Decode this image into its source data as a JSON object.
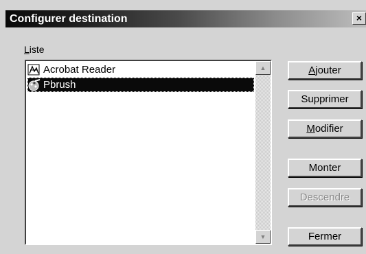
{
  "window": {
    "title": "Configurer destination",
    "close_label": "×"
  },
  "list": {
    "label_mnemonic": "L",
    "label_rest": "iste",
    "items": [
      {
        "label": "Acrobat Reader",
        "icon": "acrobat-icon",
        "selected": false
      },
      {
        "label": "Pbrush",
        "icon": "paintbrush-icon",
        "selected": true
      }
    ],
    "scroll_up": "▲",
    "scroll_down": "▼"
  },
  "buttons": {
    "ajouter": {
      "mnemonic": "A",
      "rest": "jouter"
    },
    "supprimer": {
      "label": "Supprimer"
    },
    "modifier": {
      "mnemonic": "M",
      "rest": "odifier"
    },
    "monter": {
      "label": "Monter"
    },
    "descendre": {
      "label": "Descendre",
      "disabled": true
    },
    "fermer": {
      "label": "Fermer"
    }
  }
}
